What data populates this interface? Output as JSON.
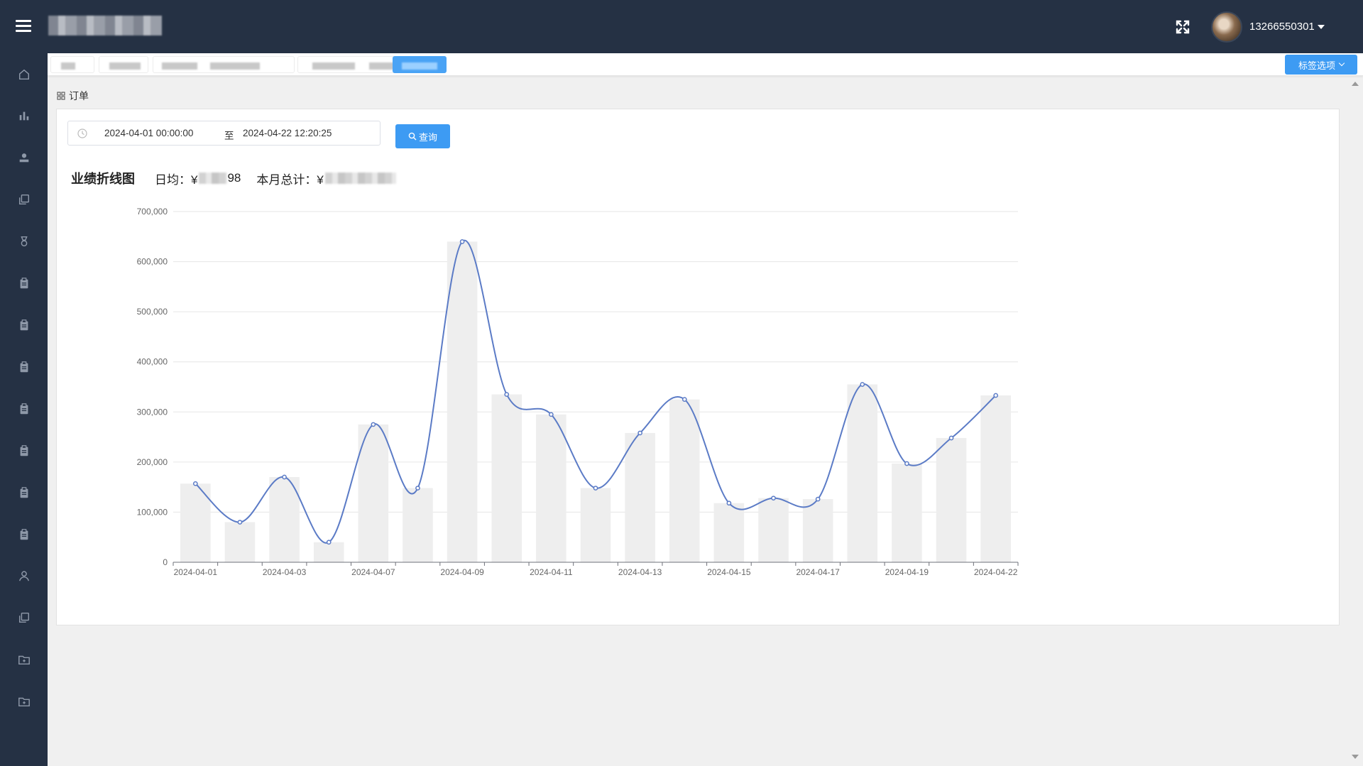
{
  "header": {
    "username": "13266550301"
  },
  "tags": {
    "options_label": "标签选项"
  },
  "breadcrumb": {
    "label": "订单"
  },
  "filter": {
    "start": "2024-04-01 00:00:00",
    "separator": "至",
    "end": "2024-04-22 12:20:25",
    "query_label": "查询"
  },
  "stats": {
    "title": "业绩折线图",
    "daily_avg_label": "日均：¥",
    "daily_avg_tail": "98",
    "month_total_label": "本月总计：¥"
  },
  "chart_data": {
    "type": "line",
    "title": "",
    "xlabel": "",
    "ylabel": "",
    "ylim": [
      0,
      700000
    ],
    "yticks": [
      0,
      100000,
      200000,
      300000,
      400000,
      500000,
      600000,
      700000
    ],
    "ytick_labels": [
      "0",
      "100,000",
      "200,000",
      "300,000",
      "400,000",
      "500,000",
      "600,000",
      "700,000"
    ],
    "xtick_labels": [
      "2024-04-01",
      "2024-04-03",
      "2024-04-07",
      "2024-04-09",
      "2024-04-11",
      "2024-04-13",
      "2024-04-15",
      "2024-04-17",
      "2024-04-19",
      "2024-04-22"
    ],
    "categories": [
      "2024-04-01",
      "2024-04-02",
      "2024-04-03",
      "2024-04-05",
      "2024-04-07",
      "2024-04-08",
      "2024-04-09",
      "2024-04-10",
      "2024-04-11",
      "2024-04-12",
      "2024-04-13",
      "2024-04-14",
      "2024-04-15",
      "2024-04-16",
      "2024-04-17",
      "2024-04-18",
      "2024-04-19",
      "2024-04-20",
      "2024-04-22"
    ],
    "series": [
      {
        "type": "line",
        "values": [
          157000,
          80000,
          170000,
          40000,
          275000,
          148000,
          640000,
          335000,
          295000,
          148000,
          258000,
          325000,
          118000,
          128000,
          126000,
          355000,
          197000,
          248000,
          333000
        ],
        "color": "#5b7bc6"
      },
      {
        "type": "bar",
        "values": [
          157000,
          80000,
          170000,
          40000,
          275000,
          148000,
          640000,
          335000,
          295000,
          148000,
          258000,
          325000,
          118000,
          128000,
          126000,
          355000,
          197000,
          248000,
          333000
        ],
        "color": "#eeeeee"
      }
    ],
    "grid": true,
    "legend": "none"
  }
}
